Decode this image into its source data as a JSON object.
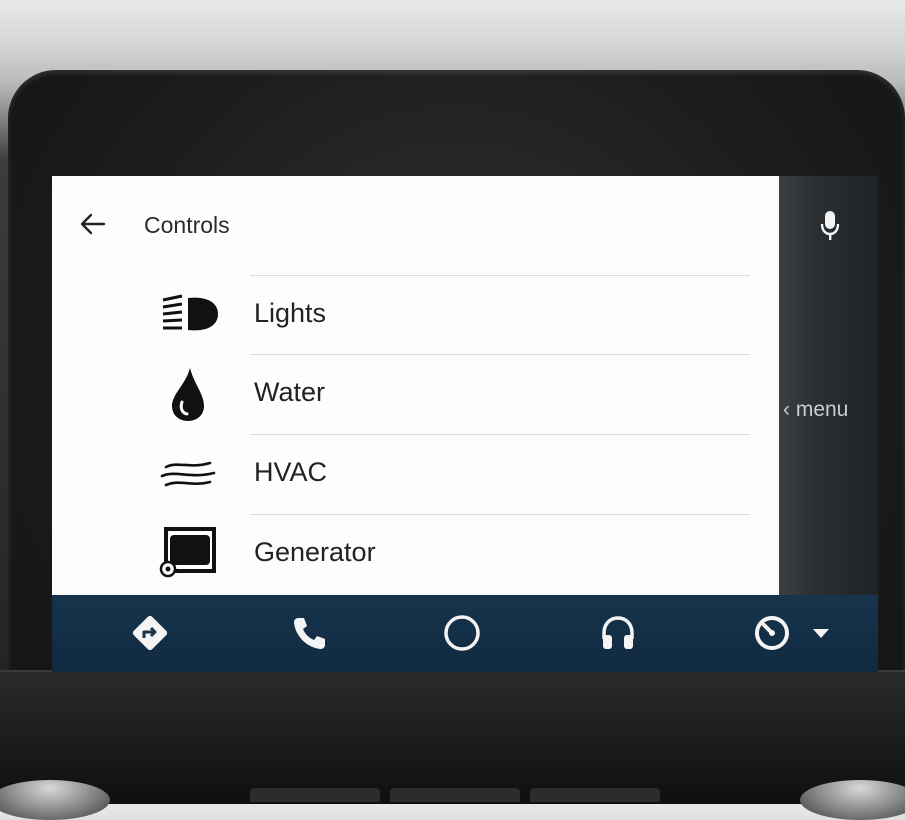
{
  "header": {
    "title": "Controls"
  },
  "items": [
    {
      "label": "Lights",
      "icon": "headlight-icon"
    },
    {
      "label": "Water",
      "icon": "water-drop-icon"
    },
    {
      "label": "HVAC",
      "icon": "air-flow-icon"
    },
    {
      "label": "Generator",
      "icon": "generator-icon"
    }
  ],
  "rail": {
    "menu_text": "‹ menu",
    "mic_icon": "microphone-icon"
  },
  "nav": [
    {
      "name": "navigation-icon"
    },
    {
      "name": "phone-icon"
    },
    {
      "name": "home-circle-icon"
    },
    {
      "name": "headphones-icon"
    },
    {
      "name": "gauge-icon"
    }
  ],
  "colors": {
    "navbar": "#17344c",
    "content_bg": "#fdfdfd",
    "rail": "#2a2e31"
  }
}
